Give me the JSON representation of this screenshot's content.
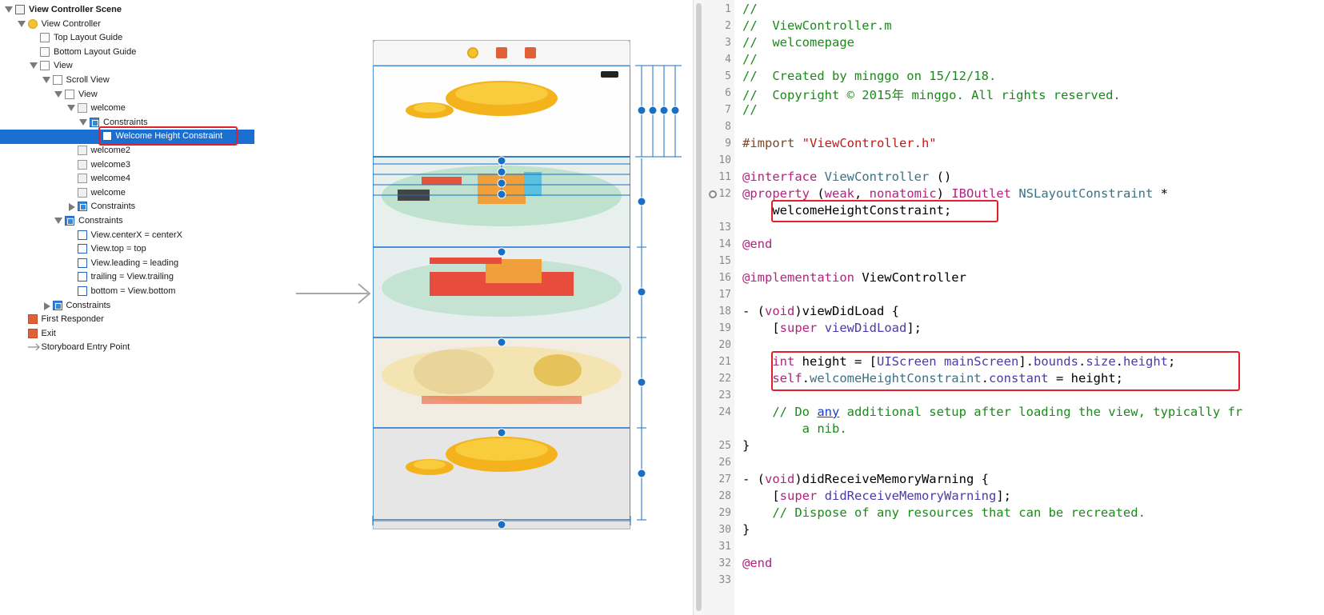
{
  "outline": {
    "items": [
      {
        "label": "View Controller Scene",
        "bold": true,
        "indent": 0,
        "disclosure": "open",
        "icon": "scene-icon"
      },
      {
        "label": "View Controller",
        "indent": 1,
        "disclosure": "open",
        "icon": "view-controller-icon"
      },
      {
        "label": "Top Layout Guide",
        "indent": 2,
        "disclosure": "none",
        "icon": "layout-guide-icon"
      },
      {
        "label": "Bottom Layout Guide",
        "indent": 2,
        "disclosure": "none",
        "icon": "layout-guide-icon"
      },
      {
        "label": "View",
        "indent": 2,
        "disclosure": "open",
        "icon": "view-icon"
      },
      {
        "label": "Scroll View",
        "indent": 3,
        "disclosure": "open",
        "icon": "scroll-view-icon"
      },
      {
        "label": "View",
        "indent": 4,
        "disclosure": "open",
        "icon": "view-icon"
      },
      {
        "label": "welcome",
        "indent": 5,
        "disclosure": "open",
        "icon": "image-view-icon"
      },
      {
        "label": "Constraints",
        "indent": 6,
        "disclosure": "open",
        "icon": "constraints-icon"
      },
      {
        "label": "Welcome Height Constraint",
        "indent": 7,
        "disclosure": "none",
        "icon": "constraint-icon",
        "selected": true
      },
      {
        "label": "welcome2",
        "indent": 5,
        "disclosure": "none",
        "icon": "image-view-icon"
      },
      {
        "label": "welcome3",
        "indent": 5,
        "disclosure": "none",
        "icon": "image-view-icon"
      },
      {
        "label": "welcome4",
        "indent": 5,
        "disclosure": "none",
        "icon": "image-view-icon"
      },
      {
        "label": "welcome",
        "indent": 5,
        "disclosure": "none",
        "icon": "image-view-icon"
      },
      {
        "label": "Constraints",
        "indent": 5,
        "disclosure": "closed",
        "icon": "constraints-icon"
      },
      {
        "label": "Constraints",
        "indent": 4,
        "disclosure": "open",
        "icon": "constraints-icon"
      },
      {
        "label": "View.centerX = centerX",
        "indent": 5,
        "disclosure": "none",
        "icon": "constraint-icon"
      },
      {
        "label": "View.top = top",
        "indent": 5,
        "disclosure": "none",
        "icon": "constraint-icon"
      },
      {
        "label": "View.leading = leading",
        "indent": 5,
        "disclosure": "none",
        "icon": "constraint-icon"
      },
      {
        "label": "trailing = View.trailing",
        "indent": 5,
        "disclosure": "none",
        "icon": "constraint-icon"
      },
      {
        "label": "bottom = View.bottom",
        "indent": 5,
        "disclosure": "none",
        "icon": "constraint-icon"
      },
      {
        "label": "Constraints",
        "indent": 3,
        "disclosure": "closed",
        "icon": "constraints-icon"
      },
      {
        "label": "First Responder",
        "indent": 1,
        "disclosure": "none",
        "icon": "first-responder-icon"
      },
      {
        "label": "Exit",
        "indent": 1,
        "disclosure": "none",
        "icon": "exit-icon"
      },
      {
        "label": "Storyboard Entry Point",
        "indent": 1,
        "disclosure": "none",
        "icon": "entry-arrow-icon"
      }
    ]
  },
  "editor": {
    "lines": [
      {
        "n": "1",
        "html": "<span class=\"cm\">//</span>"
      },
      {
        "n": "2",
        "html": "<span class=\"cm\">//  ViewController.m</span>"
      },
      {
        "n": "3",
        "html": "<span class=\"cm\">//  welcomepage</span>"
      },
      {
        "n": "4",
        "html": "<span class=\"cm\">//</span>"
      },
      {
        "n": "5",
        "html": "<span class=\"cm\">//  Created by minggo on 15/12/18.</span>"
      },
      {
        "n": "6",
        "html": "<span class=\"cm\">//  Copyright © 2015年 minggo. All rights reserved.</span>"
      },
      {
        "n": "7",
        "html": "<span class=\"cm\">//</span>"
      },
      {
        "n": "8",
        "html": ""
      },
      {
        "n": "9",
        "html": "<span class=\"pp\">#import </span><span class=\"st\">\"ViewController.h\"</span>"
      },
      {
        "n": "10",
        "html": ""
      },
      {
        "n": "11",
        "html": "<span class=\"kw\">@interface</span> <span class=\"ty\">ViewController</span> ()"
      },
      {
        "n": "12",
        "html": "<span class=\"kw\">@property</span> (<span class=\"kw\">weak</span>, <span class=\"kw\">nonatomic</span>) <span class=\"kw\">IBOutlet</span> <span class=\"ty\">NSLayoutConstraint</span> *"
      },
      {
        "n": "",
        "html": "    welcomeHeightConstraint;"
      },
      {
        "n": "13",
        "html": ""
      },
      {
        "n": "14",
        "html": "<span class=\"kw\">@end</span>"
      },
      {
        "n": "15",
        "html": ""
      },
      {
        "n": "16",
        "html": "<span class=\"kw\">@implementation</span> ViewController"
      },
      {
        "n": "17",
        "html": ""
      },
      {
        "n": "18",
        "html": "- (<span class=\"kw\">void</span>)viewDidLoad {"
      },
      {
        "n": "19",
        "html": "    [<span class=\"kw\">super</span> <span class=\"me\">viewDidLoad</span>];"
      },
      {
        "n": "20",
        "html": ""
      },
      {
        "n": "21",
        "html": "    <span class=\"kw\">int</span> height = [<span class=\"me\">UIScreen</span> <span class=\"me\">mainScreen</span>].<span class=\"me\">bounds</span>.<span class=\"me\">size</span>.<span class=\"me\">height</span>;"
      },
      {
        "n": "22",
        "html": "    <span class=\"kw\">self</span>.<span class=\"ty\">welcomeHeightConstraint</span>.<span class=\"me\">constant</span> = height;"
      },
      {
        "n": "23",
        "html": ""
      },
      {
        "n": "24",
        "html": "    <span class=\"cm\">// Do </span><span class=\"lk\">any</span><span class=\"cm\"> additional setup after loading the view, typically fr</span>"
      },
      {
        "n": "",
        "html": "<span class=\"cm\">        a nib.</span>"
      },
      {
        "n": "25",
        "html": "}"
      },
      {
        "n": "26",
        "html": ""
      },
      {
        "n": "27",
        "html": "- (<span class=\"kw\">void</span>)didReceiveMemoryWarning {"
      },
      {
        "n": "28",
        "html": "    [<span class=\"kw\">super</span> <span class=\"me\">didReceiveMemoryWarning</span>];"
      },
      {
        "n": "29",
        "html": "    <span class=\"cm\">// Dispose of any resources that can be recreated.</span>"
      },
      {
        "n": "30",
        "html": "}"
      },
      {
        "n": "31",
        "html": ""
      },
      {
        "n": "32",
        "html": "<span class=\"kw\">@end</span>"
      },
      {
        "n": "33",
        "html": ""
      }
    ]
  },
  "canvas": {
    "scene_bar_icons": [
      "view-controller-icon",
      "first-responder-icon",
      "exit-icon"
    ],
    "image_views": [
      "welcome",
      "welcome2",
      "welcome3",
      "welcome4",
      "welcome"
    ],
    "colors": {
      "selection": "#1a6fd1",
      "constraint": "#1a6fc4",
      "highlight": "#e0202a"
    }
  }
}
